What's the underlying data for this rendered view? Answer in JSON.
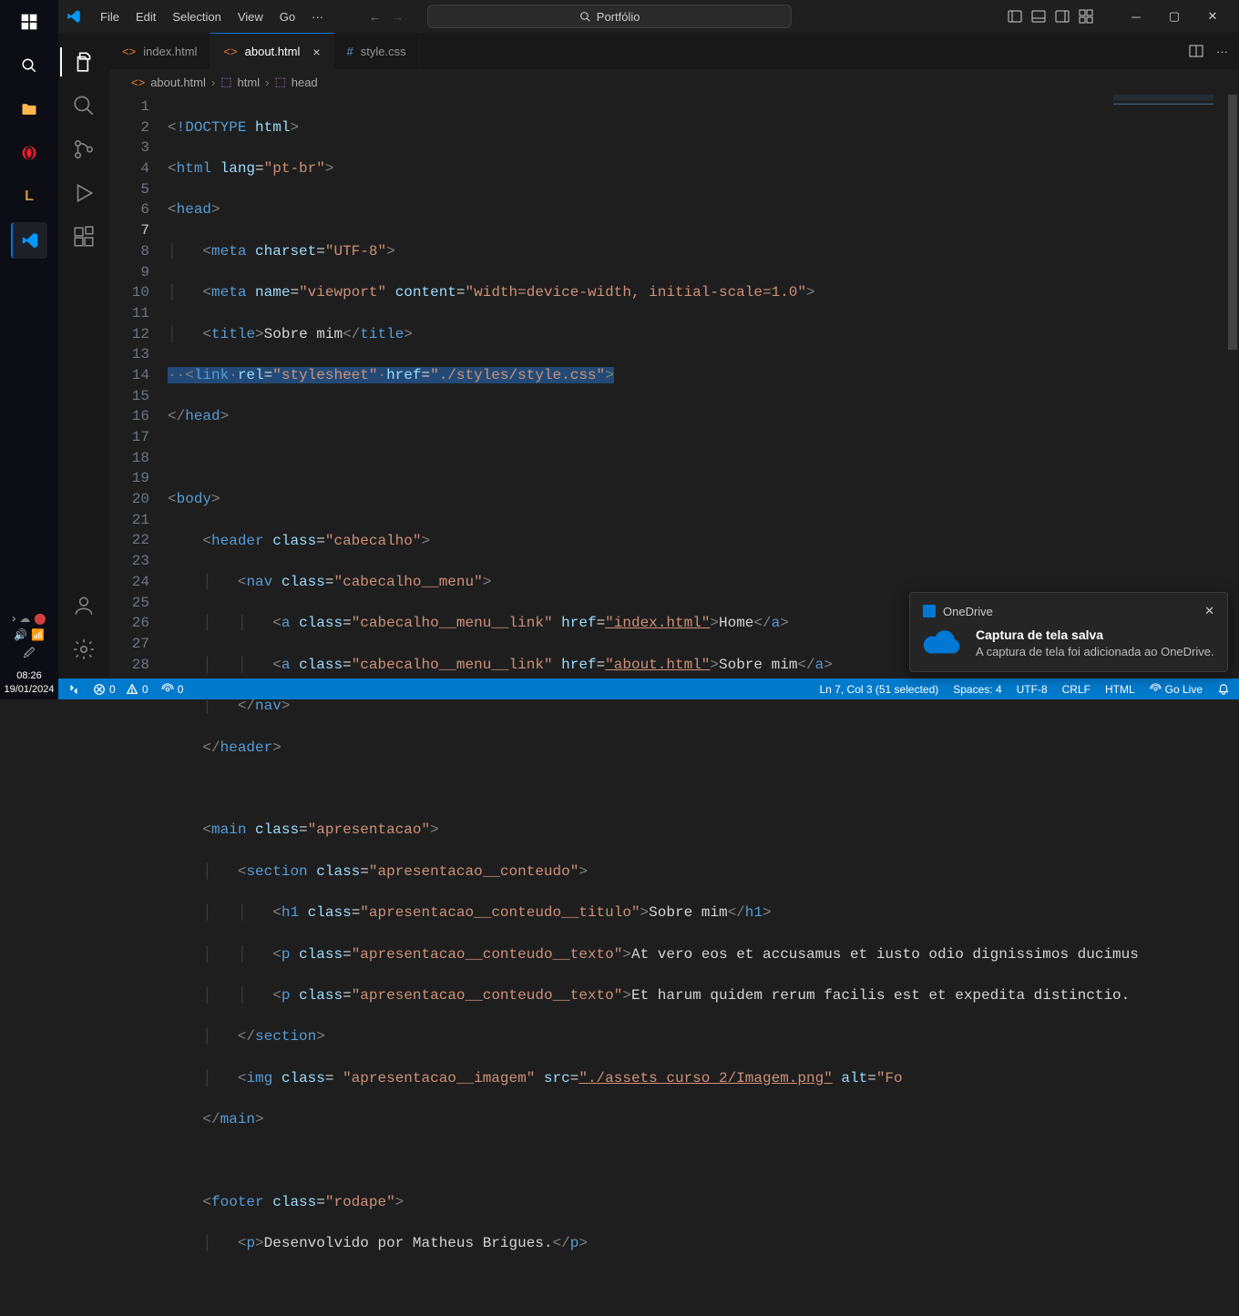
{
  "taskbar": {
    "clock_time": "08:26",
    "clock_date": "19/01/2024"
  },
  "titlebar": {
    "menu": [
      "File",
      "Edit",
      "Selection",
      "View",
      "Go"
    ],
    "search_placeholder": "Portfólio"
  },
  "tabs": [
    {
      "label": "index.html",
      "active": false,
      "type": "html"
    },
    {
      "label": "about.html",
      "active": true,
      "type": "html"
    },
    {
      "label": "style.css",
      "active": false,
      "type": "css"
    }
  ],
  "breadcrumb": [
    {
      "label": "about.html",
      "icon": "html"
    },
    {
      "label": "html",
      "icon": "sym"
    },
    {
      "label": "head",
      "icon": "sym"
    }
  ],
  "editor": {
    "line_count": 28,
    "current_line": 7
  },
  "statusbar": {
    "remote": "",
    "errors": "0",
    "warnings": "0",
    "port": "0",
    "cursor": "Ln 7, Col 3 (51 selected)",
    "spaces": "Spaces: 4",
    "encoding": "UTF-8",
    "eol": "CRLF",
    "lang": "HTML",
    "golive": "Go Live"
  },
  "notification": {
    "app": "OneDrive",
    "title": "Captura de tela salva",
    "message": "A captura de tela foi adicionada ao OneDrive."
  },
  "code_content": {
    "line1_doctype": "!DOCTYPE",
    "line1_html": "html",
    "lang_attr": "lang",
    "lang_val": "\"pt-br\"",
    "head": "head",
    "meta": "meta",
    "charset": "charset",
    "charset_val": "\"UTF-8\"",
    "name": "name",
    "viewport_val": "\"viewport\"",
    "content": "content",
    "content_val": "\"width=device-width, initial-scale=1.0\"",
    "title": "title",
    "title_text": "Sobre mim",
    "link": "link",
    "rel": "rel",
    "rel_val": "\"stylesheet\"",
    "href": "href",
    "href_val": "\"./styles/style.css\"",
    "body": "body",
    "header": "header",
    "class": "class",
    "cabecalho": "\"cabecalho\"",
    "nav": "nav",
    "cabecalho_menu": "\"cabecalho__menu\"",
    "a": "a",
    "cabecalho_link": "\"cabecalho__menu__link\"",
    "index_href": "\"index.html\"",
    "home_text": "Home",
    "about_href": "\"about.html\"",
    "sobre_text": "Sobre mim",
    "main": "main",
    "apresentacao": "\"apresentacao\"",
    "section": "section",
    "apresentacao_conteudo": "\"apresentacao__conteudo\"",
    "h1": "h1",
    "apresentacao_titulo": "\"apresentacao__conteudo__titulo\"",
    "h1_text": "Sobre mim",
    "p": "p",
    "apresentacao_texto": "\"apresentacao__conteudo__texto\"",
    "p1_text": "At vero eos et accusamus et iusto odio dignissimos ducimus",
    "p2_text": "Et harum quidem rerum facilis est et expedita distinctio.",
    "img": "img",
    "apresentacao_imagem": "\"apresentacao__imagem\"",
    "src": "src",
    "src_val": "\"./assets curso 2/Imagem.png\"",
    "alt": "alt",
    "alt_val": "\"Fo",
    "footer": "footer",
    "rodape": "\"rodape\"",
    "footer_text": "Desenvolvido por Matheus Brigues.",
    "html": "html"
  }
}
